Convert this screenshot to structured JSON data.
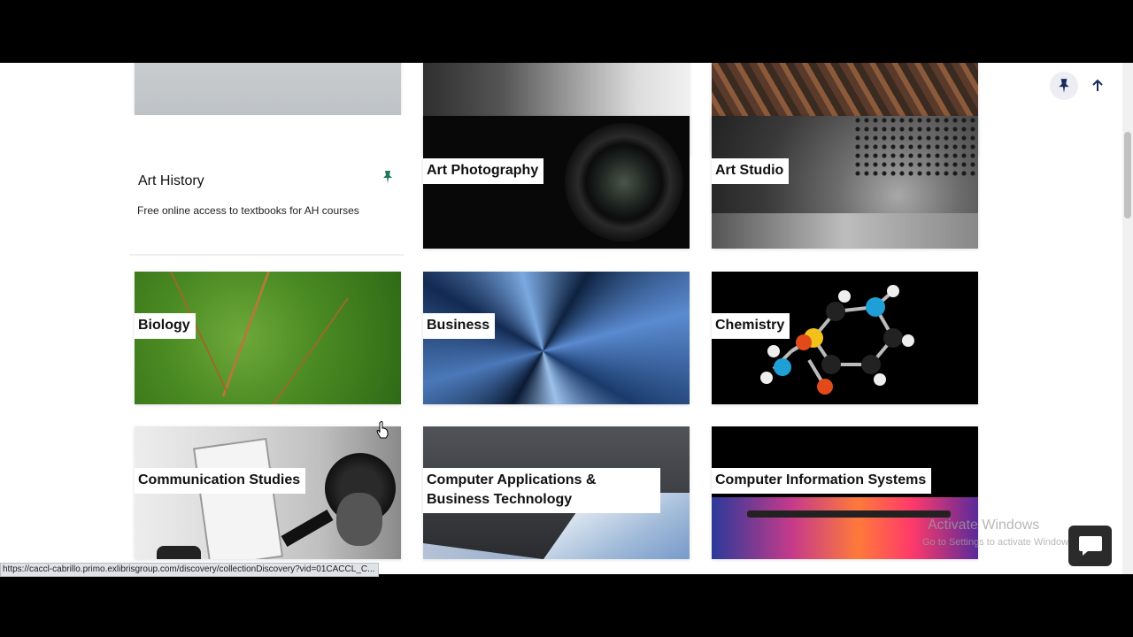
{
  "art_history": {
    "title": "Art History",
    "description": "Free online access to textbooks for AH courses"
  },
  "subjects": [
    {
      "name": "Art Photography"
    },
    {
      "name": "Art Studio"
    },
    {
      "name": "Biology"
    },
    {
      "name": "Business"
    },
    {
      "name": "Chemistry"
    },
    {
      "name": "Communication Studies"
    },
    {
      "name": "Computer Applications & Business Technology"
    },
    {
      "name": "Computer Information Systems"
    }
  ],
  "status_url": "https://caccl-cabrillo.primo.exlibrisgroup.com/discovery/collectionDiscovery?vid=01CACCL_C...",
  "watermark": {
    "line1": "Activate Windows",
    "line2": "Go to Settings to activate Windows."
  },
  "icons": {
    "pin": "pin-icon",
    "scroll_top": "arrow-up-icon",
    "chat": "chat-bubble-icon"
  },
  "colors": {
    "pin_green": "#1f7a55",
    "pin_navy": "#1b2b5b"
  }
}
